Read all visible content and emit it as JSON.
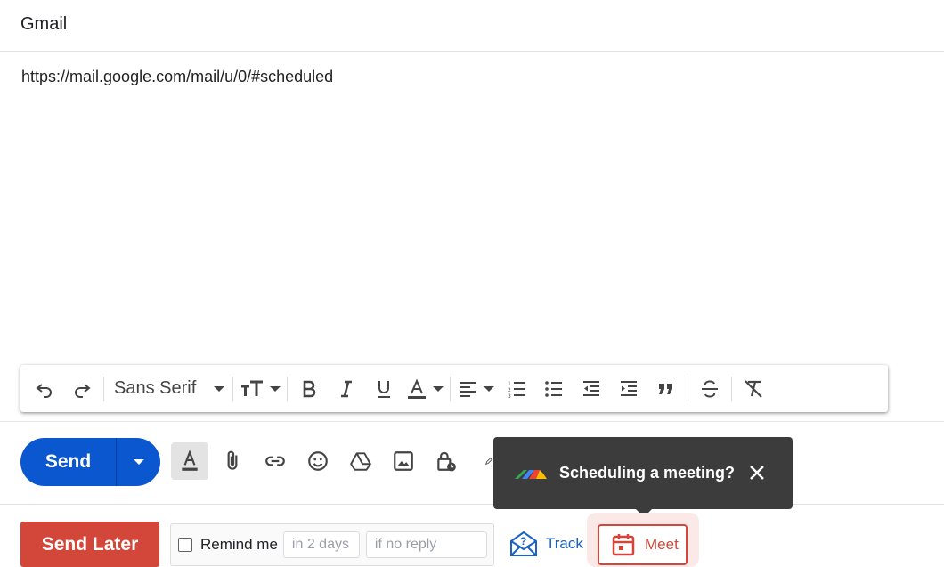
{
  "app": {
    "title": "Gmail"
  },
  "message": {
    "body_text": "https://mail.google.com/mail/u/0/#scheduled"
  },
  "format_toolbar": {
    "font_family": "Sans Serif",
    "buttons": [
      "undo",
      "redo",
      "font-size",
      "bold",
      "italic",
      "underline",
      "text-color",
      "align",
      "numbered-list",
      "bulleted-list",
      "indent-less",
      "indent-more",
      "quote",
      "strikethrough",
      "remove-formatting"
    ]
  },
  "compose": {
    "send_label": "Send"
  },
  "tooltip": {
    "text": "Scheduling a meeting?"
  },
  "footer": {
    "send_later_label": "Send Later",
    "remind_label": "Remind me",
    "remind_delay_placeholder": "in 2 days",
    "remind_condition_placeholder": "if no reply",
    "track_label": "Track",
    "meet_label": "Meet"
  },
  "colors": {
    "send_blue": "#0b57d0",
    "send_later_red": "#d2473a",
    "tooltip_bg": "#3c3c3c",
    "link_blue": "#1a62c6"
  }
}
